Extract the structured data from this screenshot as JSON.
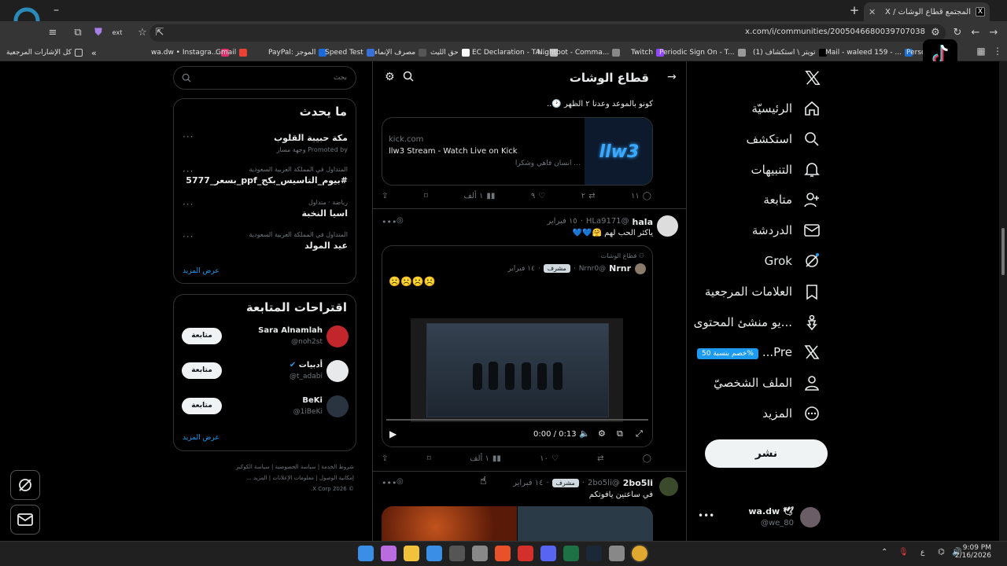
{
  "browser": {
    "tab_title": "المجتمع قطاع الوشات / X",
    "url": "x.com/i/communities/2005046680039707038",
    "bookmarks_all": "كل الإشارات المرجعية",
    "bookmarks": [
      {
        "label": "wa.dw • Instagra...",
        "color": "#e1306c"
      },
      {
        "label": "Gmail",
        "color": "#ea4335"
      },
      {
        "label": "PayPal: الموجز",
        "color": "#1b6ad8"
      },
      {
        "label": "Speed Test",
        "color": "#3a6fd8"
      },
      {
        "label": "مصرف الإنماء",
        "color": "#555"
      },
      {
        "label": "حق الليث",
        "color": "#fff"
      },
      {
        "label": "EC Declaration - TA...",
        "color": "#bbb"
      },
      {
        "label": "Nightbot - Comma...",
        "color": "#888"
      },
      {
        "label": "Twitch",
        "color": "#9146ff"
      },
      {
        "label": "Periodic Sign On - T...",
        "color": "#999"
      },
      {
        "label": "(1) تويتر \\ استكشاف",
        "color": "#000"
      },
      {
        "label": "Mail - waleed 159 - ...",
        "color": "#1d6fd0"
      },
      {
        "label": "Perso",
        "color": "#777"
      }
    ]
  },
  "nav": {
    "items": [
      {
        "label": "الرئيسيّة",
        "icon": "home-icon"
      },
      {
        "label": "استكشف",
        "icon": "search-icon"
      },
      {
        "label": "التنبيهات",
        "icon": "bell-icon"
      },
      {
        "label": "متابعة",
        "icon": "person-add-icon"
      },
      {
        "label": "الدردشة",
        "icon": "mail-icon"
      },
      {
        "label": "Grok",
        "icon": "grok-icon"
      },
      {
        "label": "العلامات المرجعية",
        "icon": "bookmark-icon"
      },
      {
        "label": "...يو منشئ المحتوى",
        "icon": "creator-icon"
      },
      {
        "label": "Pre...",
        "icon": "x-logo-icon"
      },
      {
        "label": "الملف الشخصيّ",
        "icon": "profile-icon"
      },
      {
        "label": "المزيد",
        "icon": "more-icon"
      }
    ],
    "premium_badge": "%خصم بنسبة 50",
    "post_button": "نشر",
    "account_name": "wa.dw",
    "account_handle": "@we_80"
  },
  "center": {
    "title": "قطاع الوشات",
    "post0": {
      "text": "كونو بالموعد وعدنا ٢ الظهر 🕑..",
      "link_domain": "kick.com",
      "link_title": "llw3 Stream - Watch Live on Kick",
      "link_desc": "... انسان فاهي وشكرا",
      "link_thumb": "llw3",
      "replies": "١١",
      "reposts": "٢",
      "likes": "٩",
      "views": "١ ألف"
    },
    "post1": {
      "name": "hala",
      "handle": "@HLa9171",
      "date": "١٥ فبراير",
      "text": "ياكثر الحب لهم 🤗💙💙",
      "quote_community": "قطاع الوشات",
      "quote_name": "Nrnr",
      "quote_handle": "@Nrnr0",
      "quote_badge": "مشرف",
      "quote_date": "١٤ فبراير",
      "quote_text": "☹️☹️☹️☹️",
      "video_time": "0:00 / 0:13",
      "progress": 0,
      "likes": "١٠",
      "views": "١ ألف"
    },
    "post2": {
      "name": "2bo5li",
      "handle": "@2bo5li",
      "badge": "مشرف",
      "date": "١٤ فبراير",
      "text": "في ساعتين يافوتكم"
    }
  },
  "sidebar": {
    "search_placeholder": "بحث",
    "trends_title": "ما يحدث",
    "trends": [
      {
        "meta": "",
        "title": "مكة حبيبة القلوب",
        "promoted": "Promoted by وجهة مسار"
      },
      {
        "meta": "المتداول في المملكة العربية السعودية",
        "title": "#بيوم_التاسيس_بكج_ppf_بسعر_5777"
      },
      {
        "meta": "رياضة · متداول",
        "title": "اسيا النخبة"
      },
      {
        "meta": "المتداول في المملكة العربية السعودية",
        "title": "عيد المولد"
      }
    ],
    "show_more": "عرض المزيد",
    "follow_title": "اقتراحات المتابعة",
    "follow_button": "متابعة",
    "suggestions": [
      {
        "name": "Sara Alnamlah",
        "handle": "@noh2st",
        "color": "#c0262b"
      },
      {
        "name": "أدبيات",
        "handle": "@t_adabi",
        "color": "#e7e9ea",
        "verified": true
      },
      {
        "name": "BeKi",
        "handle": "@1iBeKi",
        "color": "#2a3440"
      }
    ],
    "footer": [
      "شروط الخدمة",
      "سياسة الخصوصية",
      "سياسة الكوكيز",
      "إمكانية الوصول",
      "معلومات الإعلانات",
      "المزيد ...",
      "© 2026 X Corp."
    ]
  },
  "taskbar": {
    "time": "9:09 PM",
    "date": "2/16/2026",
    "lang": "ع"
  }
}
